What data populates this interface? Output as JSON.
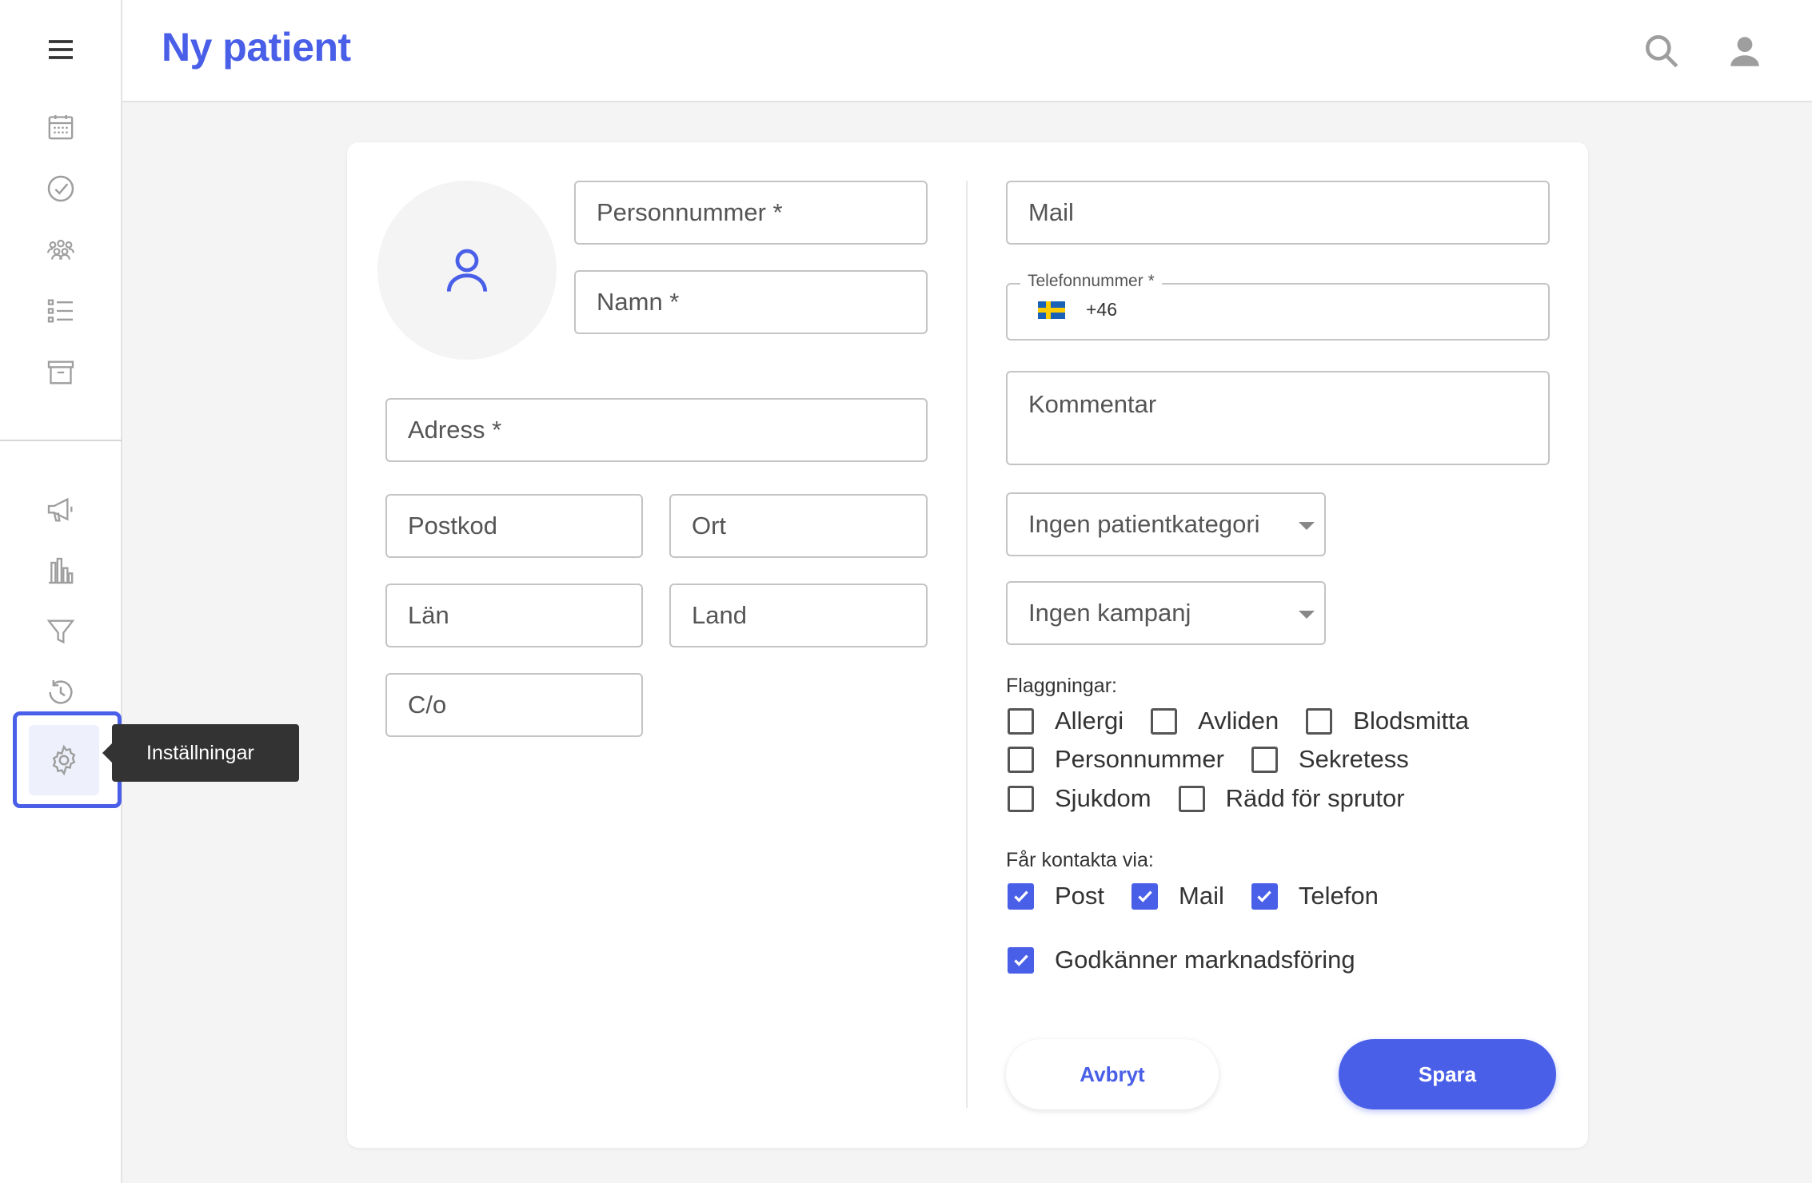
{
  "header": {
    "title": "Ny patient"
  },
  "tooltip": {
    "text": "Inställningar"
  },
  "form": {
    "personnummer": "Personnummer *",
    "namn": "Namn *",
    "adress": "Adress *",
    "postkod": "Postkod",
    "ort": "Ort",
    "lan": "Län",
    "land": "Land",
    "co": "C/o",
    "mail": "Mail",
    "telefon_label": "Telefonnummer *",
    "telefon_prefix": "+46",
    "kommentar": "Kommentar",
    "patientkategori": "Ingen patientkategori",
    "kampanj": "Ingen kampanj"
  },
  "flags": {
    "label": "Flaggningar:",
    "items": [
      {
        "label": "Allergi",
        "checked": false
      },
      {
        "label": "Avliden",
        "checked": false
      },
      {
        "label": "Blodsmitta",
        "checked": false
      },
      {
        "label": "Personnummer",
        "checked": false
      },
      {
        "label": "Sekretess",
        "checked": false
      },
      {
        "label": "Sjukdom",
        "checked": false
      },
      {
        "label": "Rädd för sprutor",
        "checked": false
      }
    ]
  },
  "contact": {
    "label": "Får kontakta via:",
    "items": [
      {
        "label": "Post",
        "checked": true
      },
      {
        "label": "Mail",
        "checked": true
      },
      {
        "label": "Telefon",
        "checked": true
      }
    ]
  },
  "marketing": {
    "label": "Godkänner marknadsföring",
    "checked": true
  },
  "buttons": {
    "cancel": "Avbryt",
    "save": "Spara"
  },
  "colors": {
    "accent": "#4a5fe8",
    "icon_gray": "#9e9e9e",
    "tooltip_bg": "#333333"
  }
}
